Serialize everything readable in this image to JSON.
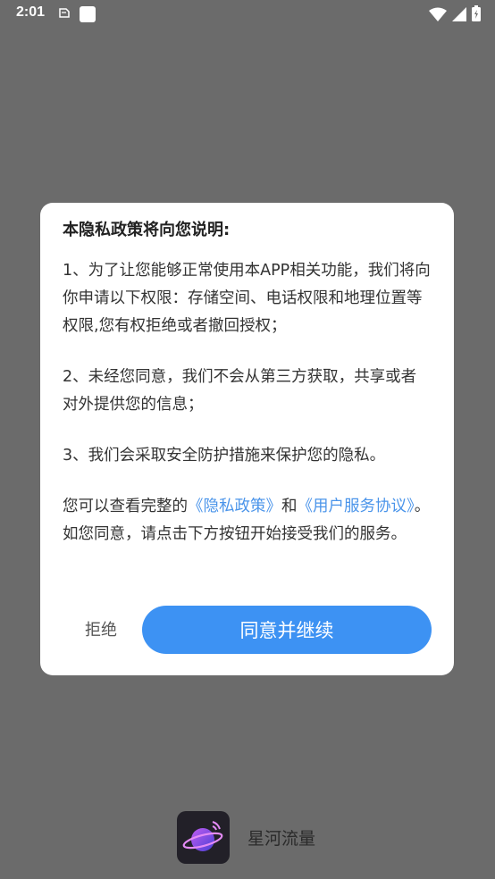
{
  "status_bar": {
    "time": "2:01"
  },
  "dialog": {
    "title": "本隐私政策将向您说明:",
    "para1": "1、为了让您能够正常使用本APP相关功能，我们将向你申请以下权限：存储空间、电话权限和地理位置等权限,您有权拒绝或者撤回授权；",
    "para2": "2、未经您同意，我们不会从第三方获取，共享或者对外提供您的信息；",
    "para3": "3、我们会采取安全防护措施来保护您的隐私。",
    "para4": {
      "prefix": "您可以查看完整的",
      "privacy_link": "《隐私政策》",
      "and": "和",
      "terms_link": "《用户服务协议》",
      "suffix": "。如您同意，请点击下方按钮开始接受我们的服务。"
    },
    "reject_label": "拒绝",
    "agree_label": "同意并继续"
  },
  "app": {
    "name": "星河流量"
  }
}
